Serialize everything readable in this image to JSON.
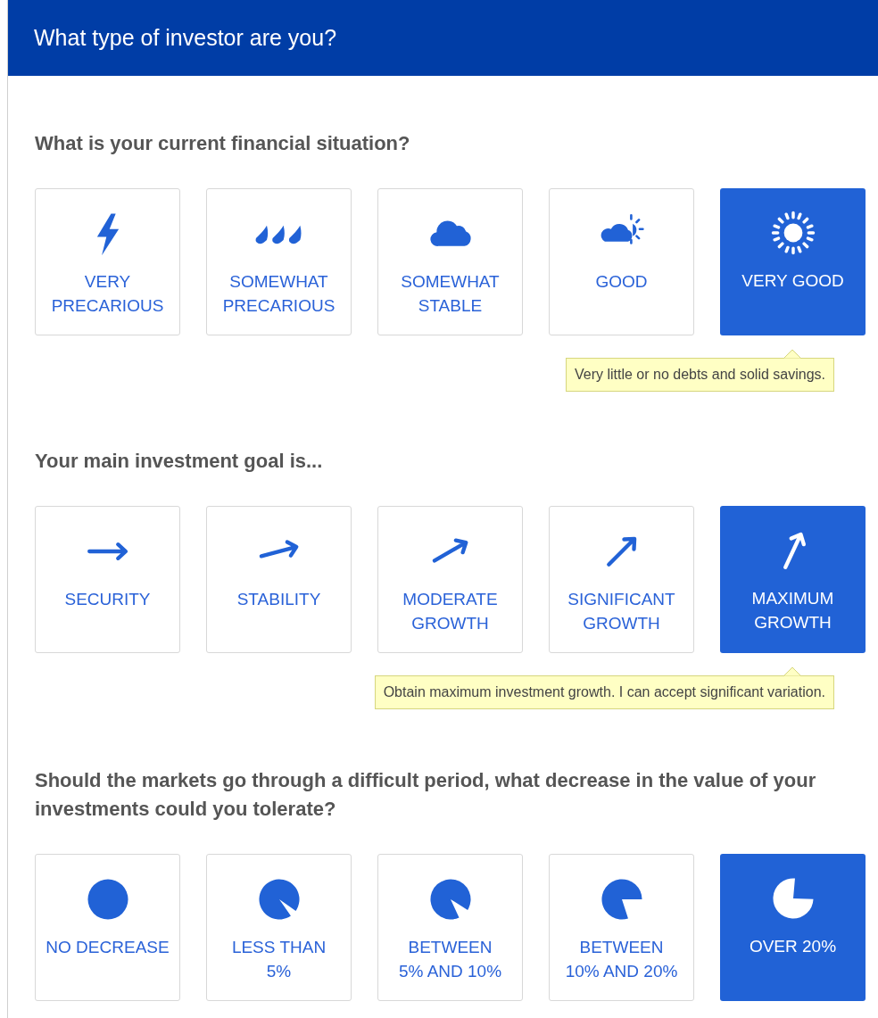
{
  "header": {
    "title": "What type of investor are you?"
  },
  "questions": [
    {
      "title": "What is your current financial situation?",
      "options": [
        {
          "lines": [
            "VERY",
            "PRECARIOUS"
          ],
          "selected": false
        },
        {
          "lines": [
            "SOMEWHAT",
            "PRECARIOUS"
          ],
          "selected": false
        },
        {
          "lines": [
            "SOMEWHAT",
            "STABLE"
          ],
          "selected": false
        },
        {
          "lines": [
            "GOOD"
          ],
          "selected": false
        },
        {
          "lines": [
            "VERY GOOD"
          ],
          "selected": true
        }
      ],
      "tooltip": "Very little or no debts and solid savings."
    },
    {
      "title": "Your main investment goal is...",
      "options": [
        {
          "lines": [
            "SECURITY"
          ],
          "selected": false
        },
        {
          "lines": [
            "STABILITY"
          ],
          "selected": false
        },
        {
          "lines": [
            "MODERATE",
            "GROWTH"
          ],
          "selected": false
        },
        {
          "lines": [
            "SIGNIFICANT",
            "GROWTH"
          ],
          "selected": false
        },
        {
          "lines": [
            "MAXIMUM",
            "GROWTH"
          ],
          "selected": true
        }
      ],
      "tooltip": "Obtain maximum investment growth. I can accept significant variation."
    },
    {
      "title": "Should the markets go through a difficult period, what decrease in the value of your investments could you tolerate?",
      "options": [
        {
          "lines": [
            "NO DECREASE"
          ],
          "selected": false
        },
        {
          "lines": [
            "LESS THAN",
            "5%"
          ],
          "selected": false
        },
        {
          "lines": [
            "BETWEEN",
            "5% AND 10%"
          ],
          "selected": false
        },
        {
          "lines": [
            "BETWEEN",
            "10% AND 20%"
          ],
          "selected": false
        },
        {
          "lines": [
            "OVER 20%"
          ],
          "selected": true
        }
      ]
    }
  ]
}
